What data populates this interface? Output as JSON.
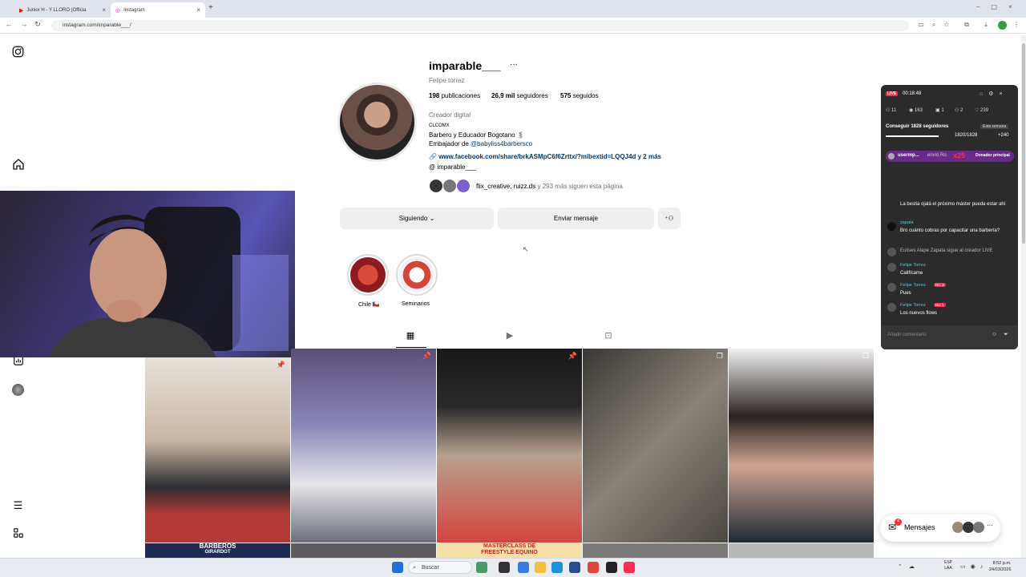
{
  "browser": {
    "tabs": [
      {
        "label": "Junior H - Y LLORO (Officia",
        "active": false
      },
      {
        "label": "Instagram",
        "active": true
      }
    ],
    "url": "instagram.com/imparable___/"
  },
  "profile": {
    "username": "imparable___",
    "more": "···",
    "fullname": "Felipe torrez",
    "posts_count": "198",
    "posts_label": "publicaciones",
    "followers_count": "26,9 mil",
    "followers_label": "seguidores",
    "following_count": "575",
    "following_label": "seguidos",
    "category": "Creador digital",
    "bio_line1": "CLCOMX",
    "bio_line2": "Barbero y Educador Bogotano 💈",
    "bio_line3_prefix": "Embajador de",
    "bio_line3_link": "@babyliss4barbersco",
    "link": "www.facebook.com/share/brkASMpC6f6Zrttx/?mibextid=LQQJ4d y 2 más",
    "threads": "imparable___",
    "followed_by_names": "flix_creative, ruizz.ds",
    "followed_by_rest": "y 293 más siguen esta página"
  },
  "actions": {
    "following": "Siguiendo",
    "message": "Enviar mensaje"
  },
  "highlights": [
    {
      "label": "Chile 🇨🇱",
      "color": "#b01c25"
    },
    {
      "label": "Seminarios",
      "color": "#c84a3a"
    }
  ],
  "grid_badges": {
    "banner1": "BARBEROS",
    "banner1_sub": "GIRARDOT",
    "banner2_line1": "MASTERCLASS DE",
    "banner2_line2": "FREESTYLE EQUINO"
  },
  "live": {
    "badge": "LIVE",
    "time": "00:18:48",
    "stats": [
      "11",
      "163",
      "1",
      "2",
      "239"
    ],
    "goal_label": "Conseguir 1828 seguidores",
    "goal_tag": "Esta semana",
    "goal_value": "1820/1828",
    "goal_delta": "+240",
    "goal_progress": 0.9956,
    "gift_user": "usermp...",
    "gift_text": "envió Ro",
    "gift_count": "x25",
    "gift_tag": "Donador principal",
    "chat": [
      {
        "name": "",
        "msg": "La bestia ojalá el próximo máster pueda estar ahí"
      },
      {
        "name": "zapata",
        "msg": "Bro cuánto cobras por capacitar una barbería?"
      },
      {
        "name": "",
        "msg": "Eulises Alape Zapata  sigue al creador LIVE"
      },
      {
        "name": "Felipe Torrez",
        "msg": "Califícame"
      },
      {
        "name": "Felipe Torrez",
        "badge": "No. 2",
        "msg": "Pues"
      },
      {
        "name": "Felipe Torrez",
        "badge": "No. 1",
        "msg": "Los nuevos flows"
      }
    ],
    "comment_placeholder": "Añadir comentario"
  },
  "messages": {
    "label": "Mensajes",
    "count": "4"
  },
  "taskbar": {
    "search": "Buscar",
    "lang1": "ESP",
    "lang2": "LAA",
    "time": "8:52 p.m.",
    "date": "24/03/2026"
  },
  "colors": {
    "link": "#00376b",
    "live_red": "#fe2c55",
    "ig_gray": "#efefef"
  }
}
